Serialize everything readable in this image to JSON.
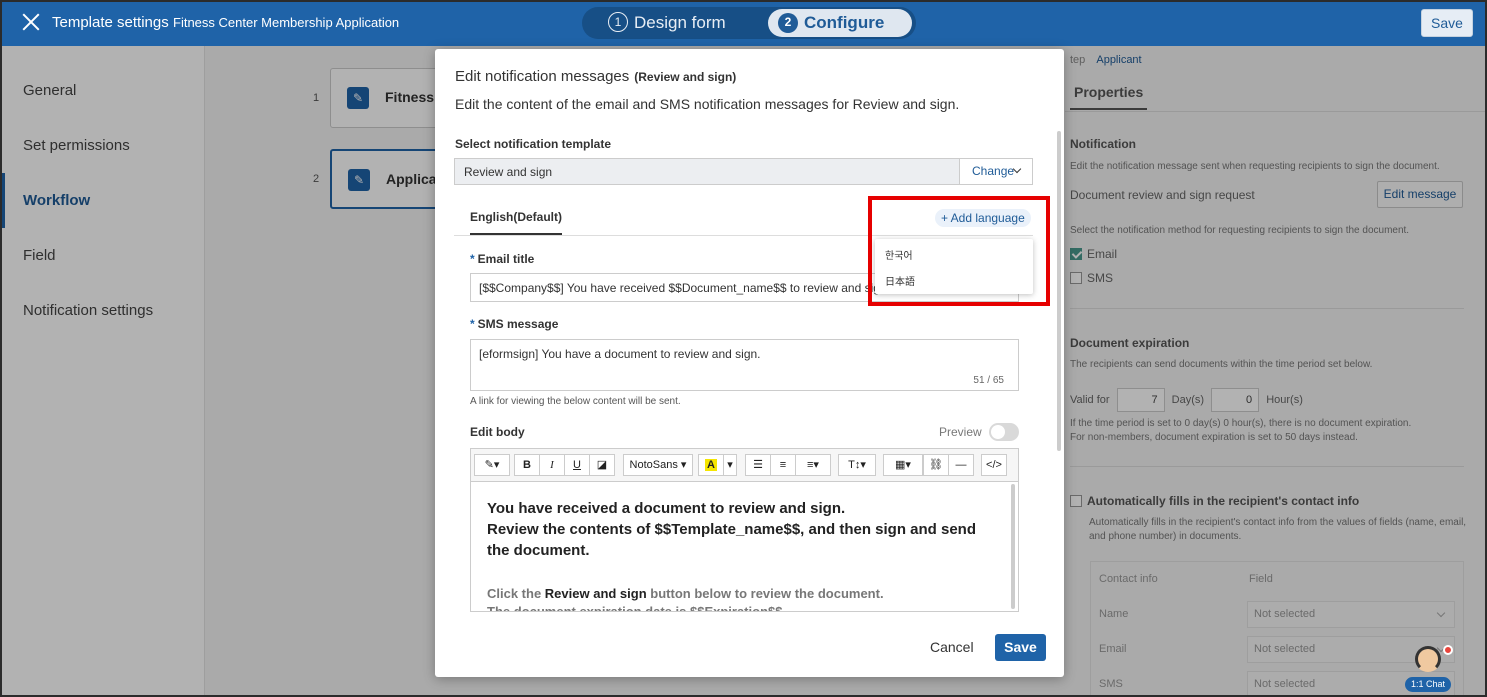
{
  "topbar": {
    "title": "Template settings",
    "subtitle": "Fitness Center Membership Application",
    "steps": [
      {
        "num": "1",
        "label": "Design form"
      },
      {
        "num": "2",
        "label": "Configure"
      }
    ],
    "save_label": "Save"
  },
  "sidebar": {
    "items": [
      {
        "label": "General"
      },
      {
        "label": "Set permissions"
      },
      {
        "label": "Workflow"
      },
      {
        "label": "Field"
      },
      {
        "label": "Notification settings"
      }
    ]
  },
  "workflow": {
    "steps": [
      {
        "num": "1",
        "label": "Fitness C"
      },
      {
        "num": "2",
        "label": "Applicar"
      }
    ]
  },
  "properties": {
    "breadcrumb_prev": "tep",
    "breadcrumb_current": "Applicant",
    "tab": "Properties",
    "notification_heading": "Notification",
    "notification_desc": "Edit the notification message sent when requesting recipients to sign the document.",
    "request_label": "Document review and sign request",
    "edit_message_label": "Edit message",
    "method_desc": "Select the notification method for requesting recipients to sign the document.",
    "email_label": "Email",
    "sms_label": "SMS",
    "expiration_heading": "Document expiration",
    "expiration_desc": "The recipients can send documents within the time period set below.",
    "valid_for": "Valid for",
    "days_value": "7",
    "days_unit": "Day(s)",
    "hours_value": "0",
    "hours_unit": "Hour(s)",
    "expiration_note1": "If the time period is set to 0 day(s) 0 hour(s), there is no document expiration.",
    "expiration_note2": "For non-members, document expiration is set to 50 days instead.",
    "autofill_label": "Automatically fills in the recipient's contact info",
    "autofill_desc": "Automatically fills in the recipient's contact info from the values of fields (name, email, and phone number) in documents.",
    "table_headers": [
      "Contact info",
      "Field"
    ],
    "table_rows": [
      {
        "info": "Name",
        "field": "Not selected"
      },
      {
        "info": "Email",
        "field": "Not selected"
      },
      {
        "info": "SMS",
        "field": "Not selected"
      }
    ]
  },
  "modal": {
    "title": "Edit notification messages",
    "title_suffix": "(Review and sign)",
    "description": "Edit the content of the email and SMS notification messages for Review and sign.",
    "template_label": "Select notification template",
    "template_value": "Review and sign",
    "change_label": "Change",
    "lang_tab": "English(Default)",
    "add_language": "+ Add language",
    "languages": [
      "한국어",
      "日本語"
    ],
    "email_title_label": "Email title",
    "email_title_value": "[$$Company$$] You have received $$Document_name$$ to review and sign.",
    "sms_label": "SMS message",
    "sms_value": "[eformsign] You have a document to review and sign.",
    "sms_counter": "51 / 65",
    "hint": "A link for viewing the below content will be sent.",
    "edit_body_label": "Edit body",
    "preview_label": "Preview",
    "toolbar": {
      "font": "NotoSans"
    },
    "body_line1": "You have received a document to review and sign.",
    "body_line2": "Review the contents of $$Template_name$$, and then sign and send the document.",
    "body_click_pre": "Click the ",
    "body_click_bold": "Review and sign",
    "body_click_post": " button below to review the document.",
    "body_partial": "The document expiration date is $$Expiration$$",
    "cancel_label": "Cancel",
    "save_label": "Save"
  },
  "chat": {
    "label": "1:1 Chat"
  }
}
